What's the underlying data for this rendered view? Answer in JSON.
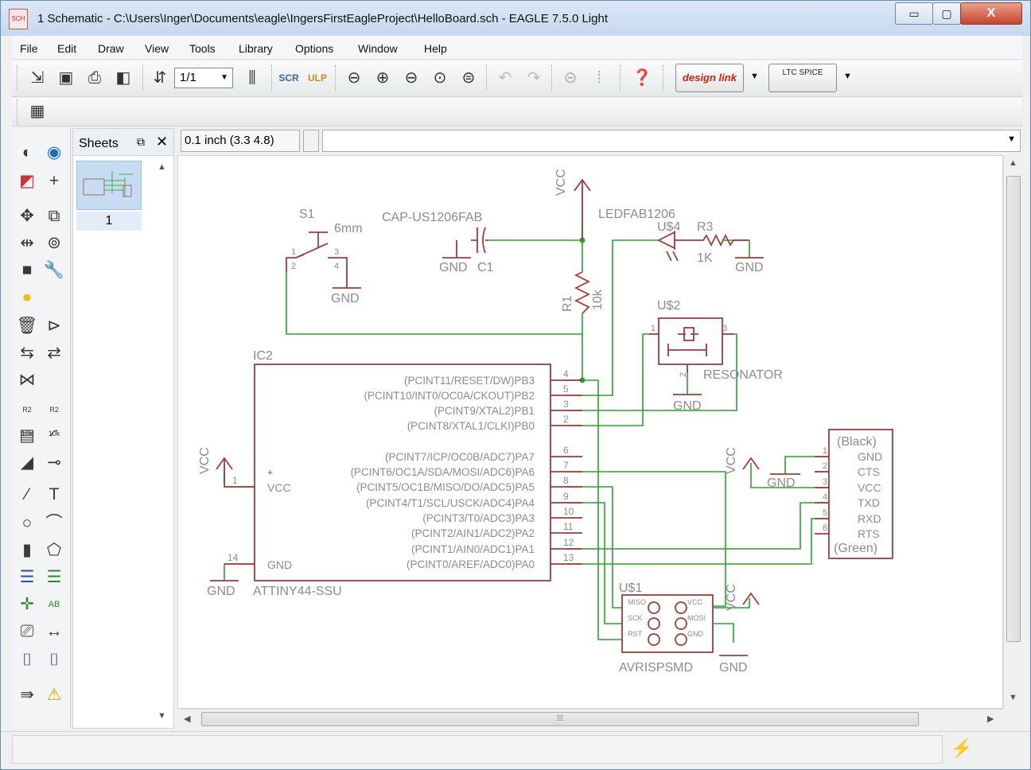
{
  "window": {
    "app_icon_label": "SCH",
    "title": "1 Schematic - C:\\Users\\Inger\\Documents\\eagle\\IngersFirstEagleProject\\HelloBoard.sch - EAGLE 7.5.0 Light",
    "minimize": "▭",
    "maximize": "▢",
    "close": "X"
  },
  "menu": [
    "File",
    "Edit",
    "Draw",
    "View",
    "Tools",
    "Library",
    "Options",
    "Window",
    "Help"
  ],
  "toolbar": {
    "sheet_select": "1/1",
    "designlink_label": "design link",
    "ltspice_label": "LTC SPICE"
  },
  "sheets_panel": {
    "title": "Sheets",
    "float_icon": "⧉",
    "close_icon": "✕",
    "sheet_number": "1"
  },
  "coord_readout": "0.1 inch (3.3 4.8)",
  "command_line": "",
  "schematic": {
    "colors": {
      "wire": "#2ca02c",
      "part": "#a33b3b",
      "text": "#8c8c8c"
    },
    "ic2": {
      "name": "IC2",
      "value": "ATTINY44-SSU",
      "left_pins": [
        {
          "num": "1",
          "label": "VCC"
        },
        {
          "num": "14",
          "label": "GND"
        }
      ],
      "right_pins": [
        {
          "num": "4",
          "label": "(PCINT11/RESET/DW)PB3"
        },
        {
          "num": "5",
          "label": "(PCINT10/INT0/OC0A/CKOUT)PB2"
        },
        {
          "num": "3",
          "label": "(PCINT9/XTAL2)PB1"
        },
        {
          "num": "2",
          "label": "(PCINT8/XTAL1/CLKI)PB0"
        },
        {
          "num": "6",
          "label": "(PCINT7/ICP/OC0B/ADC7)PA7"
        },
        {
          "num": "7",
          "label": "(PCINT6/OC1A/SDA/MOSI/ADC6)PA6"
        },
        {
          "num": "8",
          "label": "(PCINT5/OC1B/MISO/DO/ADC5)PA5"
        },
        {
          "num": "9",
          "label": "(PCINT4/T1/SCL/USCK/ADC4)PA4"
        },
        {
          "num": "10",
          "label": "(PCINT3/T0/ADC3)PA3"
        },
        {
          "num": "11",
          "label": "(PCINT2/AIN1/ADC2)PA2"
        },
        {
          "num": "12",
          "label": "(PCINT1/AIN0/ADC1)PA1"
        },
        {
          "num": "13",
          "label": "(PCINT0/AREF/ADC0)PA0"
        }
      ]
    },
    "s1": {
      "name": "S1",
      "value": "6mm",
      "pins": [
        "1",
        "2",
        "3",
        "4"
      ]
    },
    "c1": {
      "name": "C1",
      "value": "CAP-US1206FAB"
    },
    "r1": {
      "name": "R1",
      "value": "10k"
    },
    "led": {
      "name": "U$4",
      "value": "LEDFAB1206"
    },
    "r3": {
      "name": "R3",
      "value": "1K"
    },
    "u2": {
      "name": "U$2",
      "value": "RESONATOR",
      "pins": [
        "1",
        "2",
        "3"
      ]
    },
    "ftdi": {
      "top_label": "(Black)",
      "bottom_label": "(Green)",
      "pins": [
        {
          "num": "1",
          "label": "GND"
        },
        {
          "num": "2",
          "label": "CTS"
        },
        {
          "num": "3",
          "label": "VCC"
        },
        {
          "num": "4",
          "label": "TXD"
        },
        {
          "num": "5",
          "label": "RXD"
        },
        {
          "num": "6",
          "label": "RTS"
        }
      ]
    },
    "u1": {
      "name": "U$1",
      "value": "AVRISPSMD",
      "left_labels": [
        "MISO",
        "SCK",
        "RST"
      ],
      "right_labels": [
        "VCC",
        "MOSI",
        "GND"
      ]
    },
    "supply": {
      "gnd": "GND",
      "vcc": "VCC"
    }
  }
}
